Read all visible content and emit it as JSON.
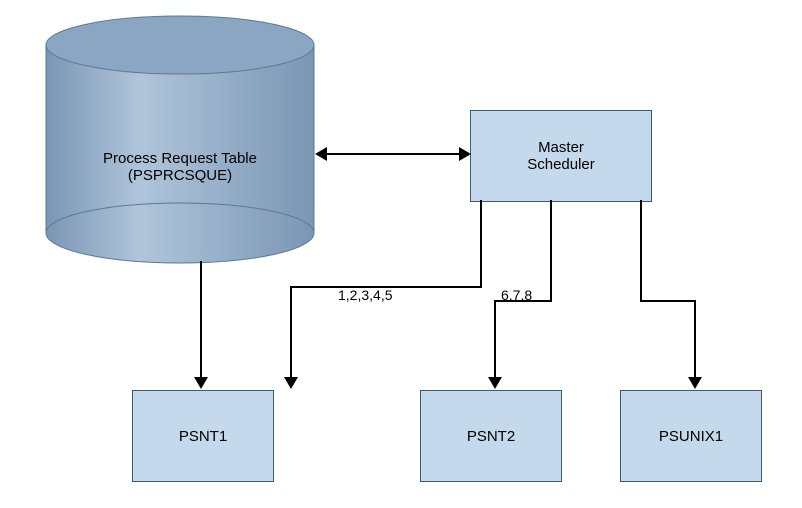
{
  "cylinder": {
    "title_line1": "Process Request Table",
    "title_line2": "(PSPRCSQUE)",
    "colors": {
      "top": "#8aa6c2",
      "body_light": "#a8bfd6",
      "body_dark": "#7593b1",
      "border": "#5a7a99"
    }
  },
  "master_scheduler": {
    "line1": "Master",
    "line2": "Scheduler"
  },
  "servers": {
    "psnt1": "PSNT1",
    "psnt2": "PSNT2",
    "psunix1": "PSUNIX1"
  },
  "edge_labels": {
    "to_psnt1": "1,2,3,4,5",
    "to_psnt2": "6,7,8"
  }
}
